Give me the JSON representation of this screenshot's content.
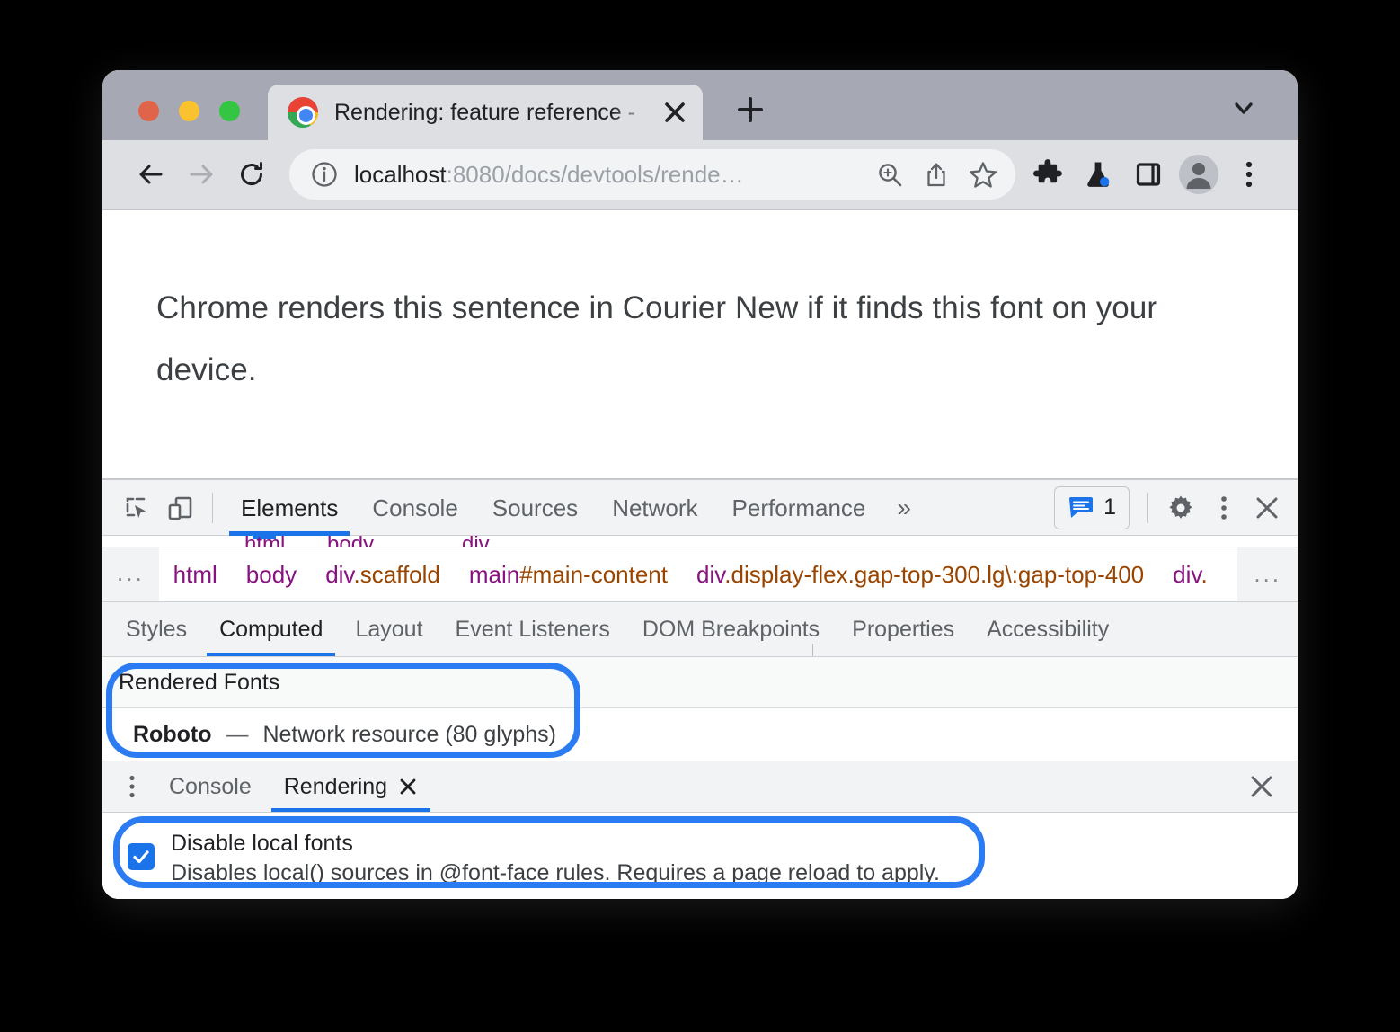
{
  "browser": {
    "tab": {
      "title": "Rendering: feature reference -",
      "close_label": "×",
      "favicon": "chrome-logo"
    },
    "new_tab_label": "+",
    "tab_list_chevron": "chevron-down-icon",
    "toolbar": {
      "back": "back-arrow-icon",
      "forward": "forward-arrow-icon",
      "reload": "reload-icon",
      "site_info": "info-icon",
      "url_host": "localhost",
      "url_path": ":8080/docs/devtools/rende…",
      "zoom": "zoom-in-icon",
      "share": "share-icon",
      "bookmark": "star-icon",
      "extensions": "puzzle-icon",
      "labs": "flask-icon",
      "side_panel": "side-panel-icon",
      "profile": "avatar-icon",
      "menu": "kebab-menu-icon"
    }
  },
  "page": {
    "sentence": "Chrome renders this sentence in Courier New if it finds this font on your device."
  },
  "devtools": {
    "inspect_icon": "inspect-element-icon",
    "device_icon": "device-toolbar-icon",
    "tabs": [
      {
        "label": "Elements",
        "active": true
      },
      {
        "label": "Console",
        "active": false
      },
      {
        "label": "Sources",
        "active": false
      },
      {
        "label": "Network",
        "active": false
      },
      {
        "label": "Performance",
        "active": false
      }
    ],
    "more_tabs_label": "»",
    "issues_count": "1",
    "issues_icon": "issues-icon",
    "settings_icon": "gear-icon",
    "more_options_icon": "kebab-menu-icon",
    "close_icon": "close-icon",
    "breadcrumb": {
      "leading_ellipsis": "...",
      "trailing_ellipsis": "...",
      "items": [
        {
          "text": "html",
          "kind": "tag"
        },
        {
          "text": "body",
          "kind": "tag"
        },
        {
          "text": "div",
          "suffix": ".scaffold",
          "kind": "tag"
        },
        {
          "text": "main",
          "suffix": "#main-content",
          "kind": "tag"
        },
        {
          "text": "div",
          "suffix": ".display-flex.gap-top-300.lg\\:gap-top-400",
          "kind": "tag"
        },
        {
          "text": "div",
          "suffix": ".",
          "kind": "tag"
        }
      ]
    },
    "subtabs": [
      {
        "label": "Styles",
        "active": false
      },
      {
        "label": "Computed",
        "active": true
      },
      {
        "label": "Layout",
        "active": false
      },
      {
        "label": "Event Listeners",
        "active": false
      },
      {
        "label": "DOM Breakpoints",
        "active": false
      },
      {
        "label": "Properties",
        "active": false
      },
      {
        "label": "Accessibility",
        "active": false
      }
    ],
    "computed": {
      "rendered_fonts_header": "Rendered Fonts",
      "font_name": "Roboto",
      "font_dash": "—",
      "font_description": "Network resource (80 glyphs)"
    },
    "drawer": {
      "menu_icon": "kebab-menu-icon",
      "tabs": [
        {
          "label": "Console",
          "active": false,
          "closable": false
        },
        {
          "label": "Rendering",
          "active": true,
          "closable": true
        }
      ],
      "tab_close_label": "×",
      "close_icon": "close-icon",
      "setting": {
        "checked": true,
        "title": "Disable local fonts",
        "description": "Disables local() sources in @font-face rules. Requires a page reload to apply."
      }
    }
  },
  "annotations": {
    "accent_color": "#2b7bf3",
    "highlight_rendered_fonts": "Rendered Fonts section callout",
    "highlight_disable_local_fonts": "Disable local fonts checkbox callout"
  }
}
